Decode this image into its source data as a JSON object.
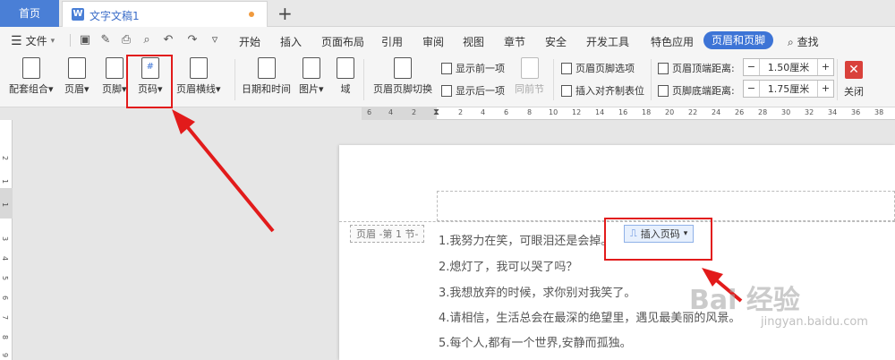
{
  "tabs": {
    "home": "首页",
    "document": "文字文稿1",
    "add": "+"
  },
  "menu": {
    "file": "文件",
    "items": [
      "开始",
      "插入",
      "页面布局",
      "引用",
      "审阅",
      "视图",
      "章节",
      "安全",
      "开发工具",
      "特色应用"
    ],
    "active": "页眉和页脚",
    "search": "查找"
  },
  "ribbon": {
    "buttons": [
      "配套组合",
      "页眉",
      "页脚",
      "页码",
      "页眉横线",
      "日期和时间",
      "图片",
      "域",
      "页眉页脚切换"
    ],
    "show_prev": "显示前一项",
    "show_next": "显示后一项",
    "same_as_prev": "同前节",
    "hf_options": "页眉页脚选项",
    "insert_align_tab": "插入对齐制表位",
    "header_top_label": "页眉顶端距离:",
    "header_top_value": "1.50厘米",
    "footer_bottom_label": "页脚底端距离:",
    "footer_bottom_value": "1.75厘米",
    "close": "关闭",
    "minus": "−",
    "plus": "+"
  },
  "ruler": {
    "h_ticks": [
      "6",
      "4",
      "2",
      "2",
      "4",
      "6",
      "8",
      "10",
      "12",
      "14",
      "16",
      "18",
      "20",
      "22",
      "24",
      "26",
      "28",
      "30",
      "32",
      "34",
      "36",
      "38"
    ],
    "v_ticks": [
      "2",
      "1",
      "1",
      "3",
      "4",
      "5",
      "6",
      "7",
      "8",
      "9"
    ]
  },
  "page": {
    "header_tag": "页眉 -第 1 节-",
    "insert_page_number": "插入页码",
    "lines": [
      "1.我努力在笑，可眼泪还是会掉。",
      "2.熄灯了，我可以哭了吗？",
      "3.我想放弃的时候，求你别对我笑了。",
      "4.请相信，生活总会在最深的绝望里，遇见最美丽的风景。",
      "5.每个人,都有一个世界,安静而孤独。"
    ]
  },
  "watermark": {
    "text": "Bai 经验",
    "url": "jingyan.baidu.com"
  },
  "colors": {
    "accent": "#3d74d6",
    "highlight": "#e21b1b"
  }
}
